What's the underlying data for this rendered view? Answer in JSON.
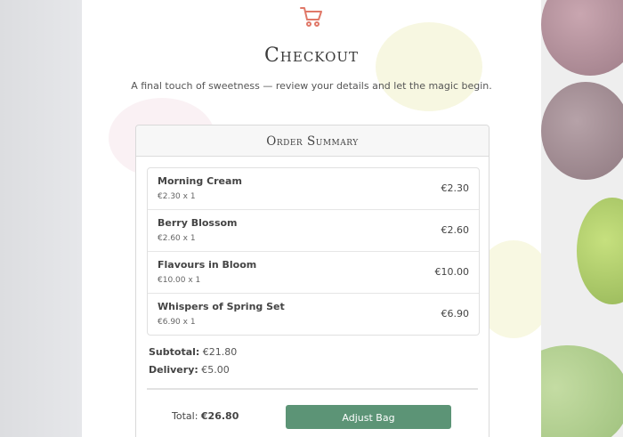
{
  "header": {
    "icon": "cart-icon",
    "title": "Checkout",
    "subtitle": "A final touch of sweetness — review your details and let the magic begin."
  },
  "summary": {
    "title": "Order Summary",
    "items": [
      {
        "name": "Morning Cream",
        "qty": "€2.30 x 1",
        "price": "€2.30"
      },
      {
        "name": "Berry Blossom",
        "qty": "€2.60 x 1",
        "price": "€2.60"
      },
      {
        "name": "Flavours in Bloom",
        "qty": "€10.00 x 1",
        "price": "€10.00"
      },
      {
        "name": "Whispers of Spring Set",
        "qty": "€6.90 x 1",
        "price": "€6.90"
      }
    ],
    "subtotal_label": "Subtotal:",
    "subtotal_value": "€21.80",
    "delivery_label": "Delivery:",
    "delivery_value": "€5.00",
    "total_label": "Total:",
    "total_value": "€26.80",
    "adjust_label": "Adjust Bag"
  },
  "colors": {
    "accent": "#e07868",
    "button": "#5c9476"
  }
}
